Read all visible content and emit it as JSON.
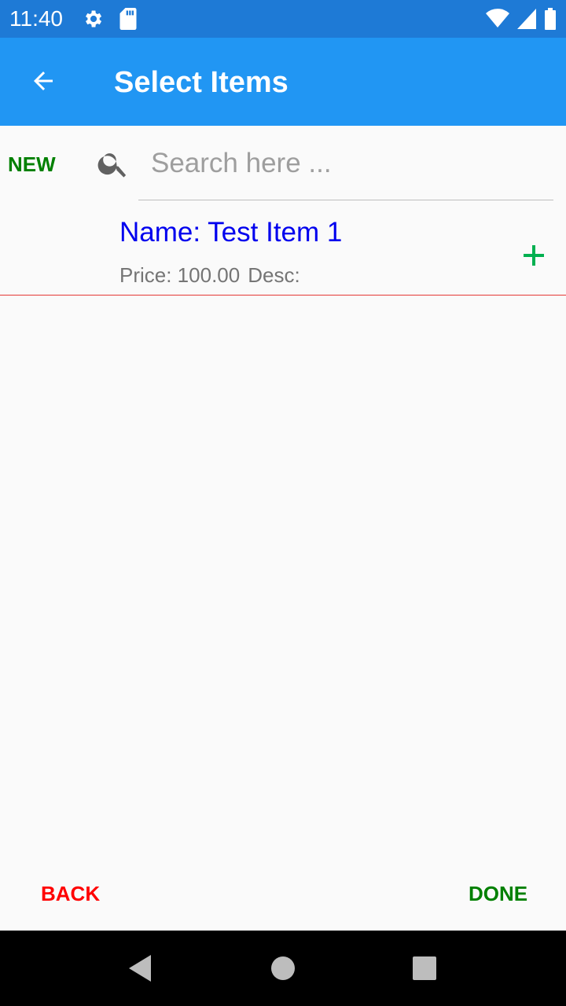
{
  "status_bar": {
    "time": "11:40",
    "icons": [
      "gear-icon",
      "sd-card-icon",
      "wifi-icon",
      "signal-icon",
      "battery-icon"
    ]
  },
  "app_bar": {
    "title": "Select Items",
    "back_icon": "arrow-left-icon"
  },
  "toolbar": {
    "new_label": "NEW",
    "search_placeholder": "Search here ...",
    "search_value": ""
  },
  "items": [
    {
      "name": "Name: Test Item 1",
      "price": "Price: 100.00",
      "desc": "Desc:",
      "add_icon": "plus-icon"
    }
  ],
  "footer": {
    "back_label": "BACK",
    "done_label": "DONE"
  },
  "colors": {
    "status_bar": "#1e7ad6",
    "app_bar": "#2196f3",
    "new": "#008000",
    "done": "#008000",
    "back": "#ff0000",
    "item_name": "#0000ee",
    "add_icon": "#00b050",
    "divider": "#e53935"
  }
}
